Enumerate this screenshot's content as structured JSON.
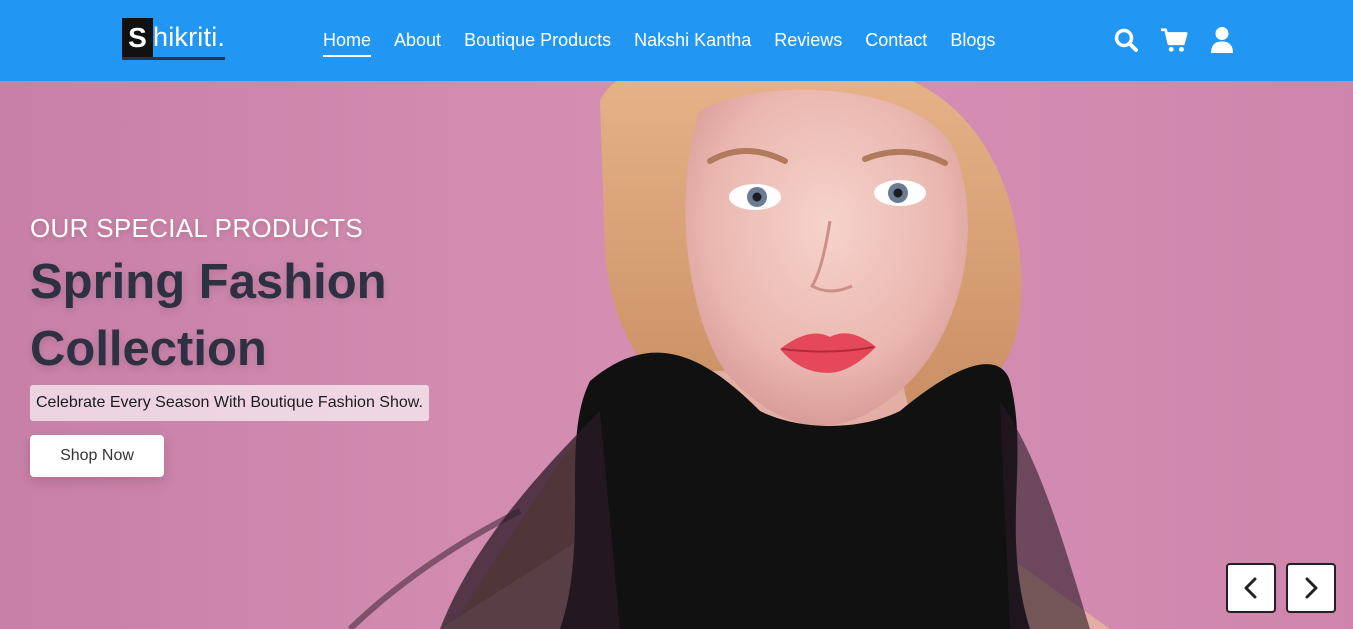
{
  "brand": {
    "mark": "S",
    "name": "hikriti."
  },
  "nav": {
    "links": [
      {
        "label": "Home",
        "active": true
      },
      {
        "label": "About"
      },
      {
        "label": "Boutique Products"
      },
      {
        "label": "Nakshi Kantha"
      },
      {
        "label": "Reviews"
      },
      {
        "label": "Contact"
      },
      {
        "label": "Blogs"
      }
    ],
    "icons": [
      "search-icon",
      "cart-icon",
      "user-icon"
    ]
  },
  "hero": {
    "subtitle": "OUR SPECIAL PRODUCTS",
    "title_line1": "Spring Fashion",
    "title_line2": "Collection",
    "tagline": "Celebrate Every Season With Boutique Fashion Show.",
    "cta": "Shop Now",
    "prev_icon": "chevron-left-icon",
    "next_icon": "chevron-right-icon"
  },
  "colors": {
    "navbar": "#2196f3",
    "hero_bg": "#d08aad",
    "title": "#2d3142"
  }
}
